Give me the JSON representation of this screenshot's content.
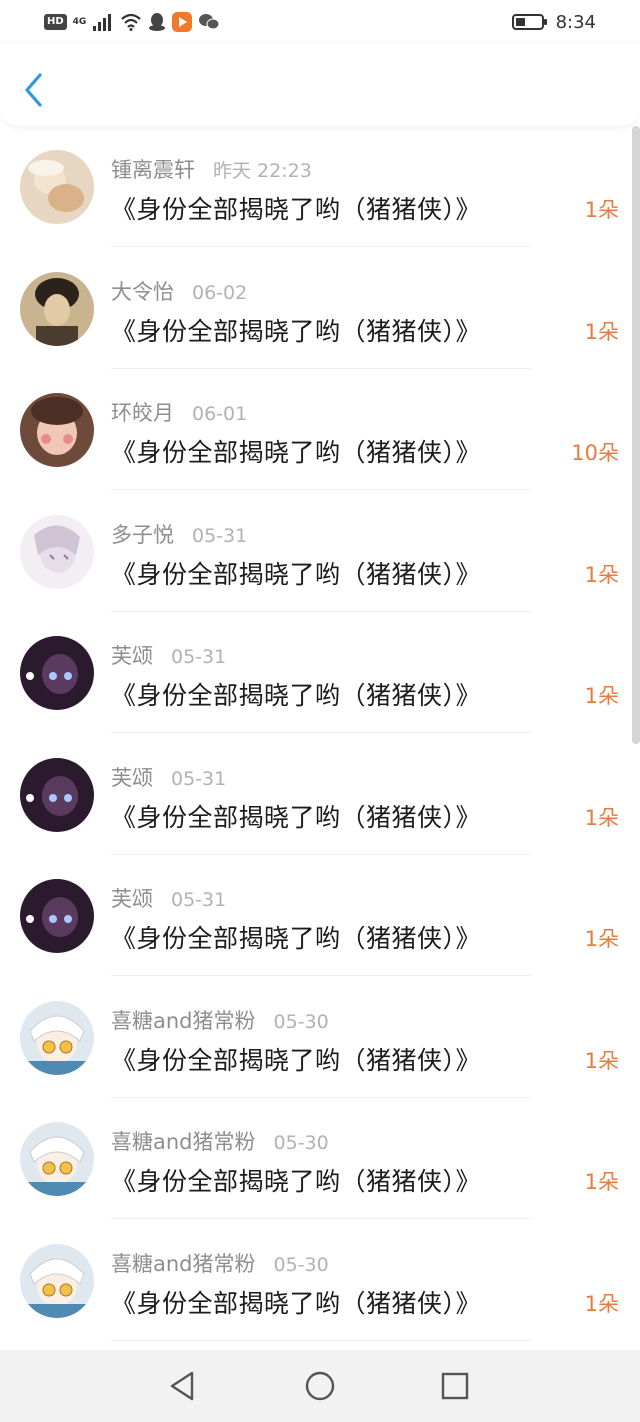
{
  "status_bar": {
    "network_hd": "HD",
    "network_4g": "4G",
    "time": "8:34",
    "icons": [
      "signal-icon",
      "wifi-icon",
      "qq-icon",
      "video-app-icon",
      "wechat-icon",
      "battery-icon"
    ]
  },
  "header": {
    "back_icon": "chevron-left-icon"
  },
  "rows": [
    {
      "user": "锺离震轩",
      "time": "昨天 22:23",
      "title": "《身份全部揭晓了哟（猪猪侠）》",
      "amount": "1朵"
    },
    {
      "user": "大令怡",
      "time": "06-02",
      "title": "《身份全部揭晓了哟（猪猪侠）》",
      "amount": "1朵"
    },
    {
      "user": "环皎月",
      "time": "06-01",
      "title": "《身份全部揭晓了哟（猪猪侠）》",
      "amount": "10朵"
    },
    {
      "user": "多子悦",
      "time": "05-31",
      "title": "《身份全部揭晓了哟（猪猪侠）》",
      "amount": "1朵"
    },
    {
      "user": "芙颂",
      "time": "05-31",
      "title": "《身份全部揭晓了哟（猪猪侠）》",
      "amount": "1朵"
    },
    {
      "user": "芙颂",
      "time": "05-31",
      "title": "《身份全部揭晓了哟（猪猪侠）》",
      "amount": "1朵"
    },
    {
      "user": "芙颂",
      "time": "05-31",
      "title": "《身份全部揭晓了哟（猪猪侠）》",
      "amount": "1朵"
    },
    {
      "user": "喜糖and猪常粉",
      "time": "05-30",
      "title": "《身份全部揭晓了哟（猪猪侠）》",
      "amount": "1朵"
    },
    {
      "user": "喜糖and猪常粉",
      "time": "05-30",
      "title": "《身份全部揭晓了哟（猪猪侠）》",
      "amount": "1朵"
    },
    {
      "user": "喜糖and猪常粉",
      "time": "05-30",
      "title": "《身份全部揭晓了哟（猪猪侠）》",
      "amount": "1朵"
    }
  ],
  "bottom_nav": {
    "icons": [
      "back-triangle-icon",
      "home-circle-icon",
      "recents-square-icon"
    ]
  },
  "colors": {
    "accent": "#2a9ae8",
    "amount": "#ec7a3c",
    "username": "#8e8e8e",
    "timestamp": "#b2b2b2",
    "title": "#1c1c1c"
  }
}
